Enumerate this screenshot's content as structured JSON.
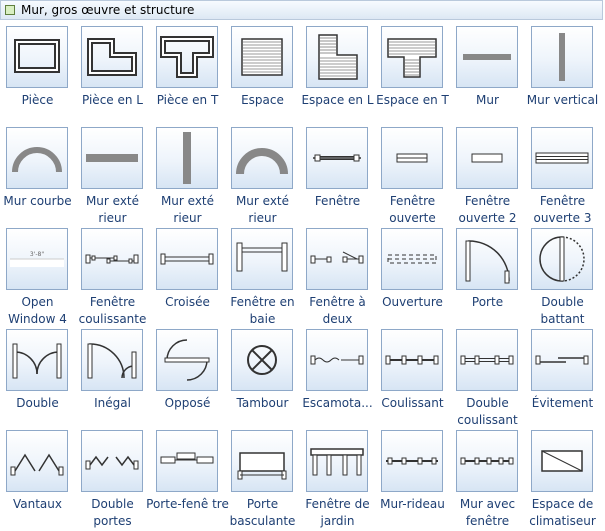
{
  "panel": {
    "title": "Mur, gros œuvre et structure"
  },
  "shapes": [
    {
      "label": "Pièce",
      "icon": "room-icon"
    },
    {
      "label": "Pièce en L",
      "icon": "l-room-icon"
    },
    {
      "label": "Pièce en T",
      "icon": "t-room-icon"
    },
    {
      "label": "Espace",
      "icon": "space-icon"
    },
    {
      "label": "Espace en L",
      "icon": "l-space-icon"
    },
    {
      "label": "Espace en T",
      "icon": "t-space-icon"
    },
    {
      "label": "Mur",
      "icon": "wall-icon"
    },
    {
      "label": "Mur vertical",
      "icon": "vertical-wall-icon"
    },
    {
      "label": "Mur courbe",
      "icon": "curved-wall-icon"
    },
    {
      "label": "Mur exté rieur",
      "icon": "exterior-wall-icon"
    },
    {
      "label": "Mur exté rieur",
      "icon": "exterior-wall-vertical-icon"
    },
    {
      "label": "Mur exté rieur",
      "icon": "exterior-curved-wall-icon"
    },
    {
      "label": "Fenêtre",
      "icon": "window-icon"
    },
    {
      "label": "Fenêtre ouverte",
      "icon": "open-window-icon"
    },
    {
      "label": "Fenêtre ouverte 2",
      "icon": "open-window-2-icon"
    },
    {
      "label": "Fenêtre ouverte 3",
      "icon": "open-window-3-icon"
    },
    {
      "label": "Open Window 4",
      "icon": "open-window-4-icon",
      "inner_text": "3'-8\""
    },
    {
      "label": "Fenêtre coulissante",
      "icon": "sliding-window-icon"
    },
    {
      "label": "Croisée",
      "icon": "casement-window-icon"
    },
    {
      "label": "Fenêtre en baie",
      "icon": "bay-window-icon"
    },
    {
      "label": "Fenêtre à deux",
      "icon": "double-hung-window-icon"
    },
    {
      "label": "Ouverture",
      "icon": "opening-icon"
    },
    {
      "label": "Porte",
      "icon": "door-icon"
    },
    {
      "label": "Double battant",
      "icon": "double-swing-door-icon"
    },
    {
      "label": "Double",
      "icon": "double-door-icon"
    },
    {
      "label": "Inégal",
      "icon": "unequal-door-icon"
    },
    {
      "label": "Opposé",
      "icon": "opposite-door-icon"
    },
    {
      "label": "Tambour",
      "icon": "revolving-door-icon"
    },
    {
      "label": "Escamota...",
      "icon": "pocket-door-icon"
    },
    {
      "label": "Coulissant",
      "icon": "sliding-door-icon"
    },
    {
      "label": "Double coulissant",
      "icon": "double-sliding-door-icon"
    },
    {
      "label": "Évitement",
      "icon": "bypass-door-icon"
    },
    {
      "label": "Vantaux",
      "icon": "bifold-door-icon"
    },
    {
      "label": "Double portes",
      "icon": "double-bifold-door-icon"
    },
    {
      "label": "Porte-fenê tre",
      "icon": "french-window-icon"
    },
    {
      "label": "Porte basculante",
      "icon": "overhead-door-icon"
    },
    {
      "label": "Fenêtre de jardin",
      "icon": "garden-window-icon"
    },
    {
      "label": "Mur-rideau",
      "icon": "curtain-wall-icon"
    },
    {
      "label": "Mur avec fenêtre",
      "icon": "wall-with-window-icon"
    },
    {
      "label": "Espace de climatiseur",
      "icon": "ac-space-icon"
    }
  ]
}
